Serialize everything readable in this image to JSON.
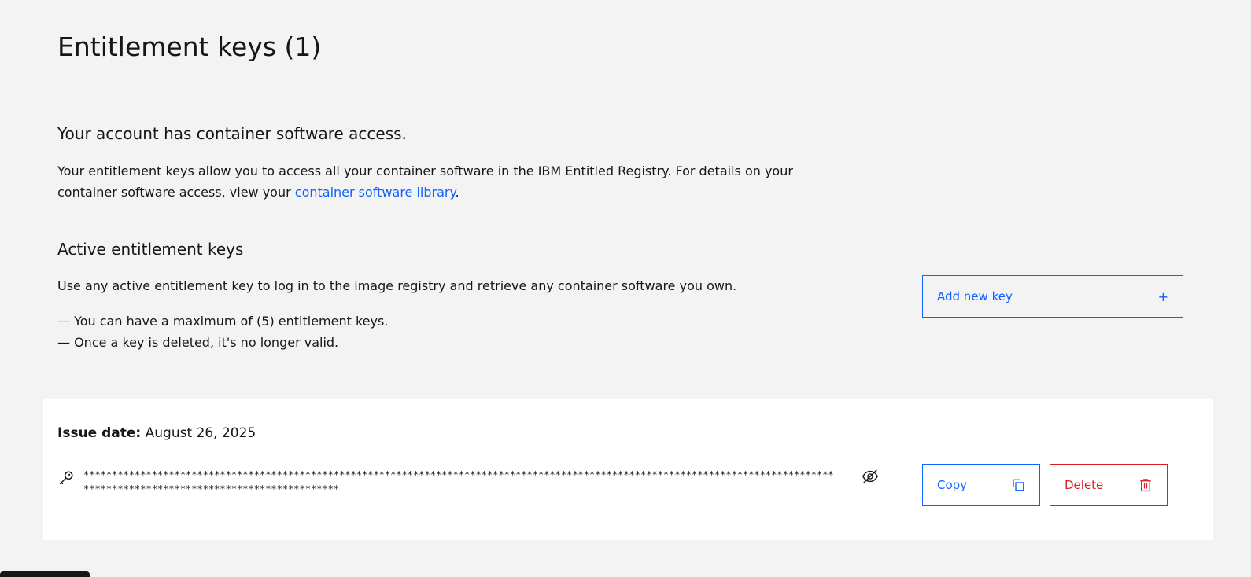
{
  "header": {
    "title": "Entitlement keys (1)"
  },
  "access": {
    "heading": "Your account has container software access.",
    "text_before_link": "Your entitlement keys allow you to access all your container software in the IBM Entitled Registry. For details on your container software access, view your ",
    "link_text": "container software library",
    "text_after_link": "."
  },
  "active": {
    "heading": "Active entitlement keys",
    "description": "Use any active entitlement key to log in to the image registry and retrieve any container software you own.",
    "note_max": "— You can have a maximum of (5) entitlement keys.",
    "note_deleted": "— Once a key is deleted, it's no longer valid.",
    "add_button_label": "Add new key",
    "add_button_icon": "+"
  },
  "key": {
    "issue_label": "Issue date:",
    "issue_date": "August 26, 2025",
    "masked_value": "*********************************************************************************************************************************************************************************",
    "copy_label": "Copy",
    "delete_label": "Delete"
  },
  "colors": {
    "background": "#f3f3f3",
    "card": "#ffffff",
    "accent": "#0f62fe",
    "danger": "#da1e28",
    "text": "#161616"
  },
  "icons": [
    "key-icon",
    "eye-off-icon",
    "copy-icon",
    "trash-icon",
    "plus-icon"
  ]
}
